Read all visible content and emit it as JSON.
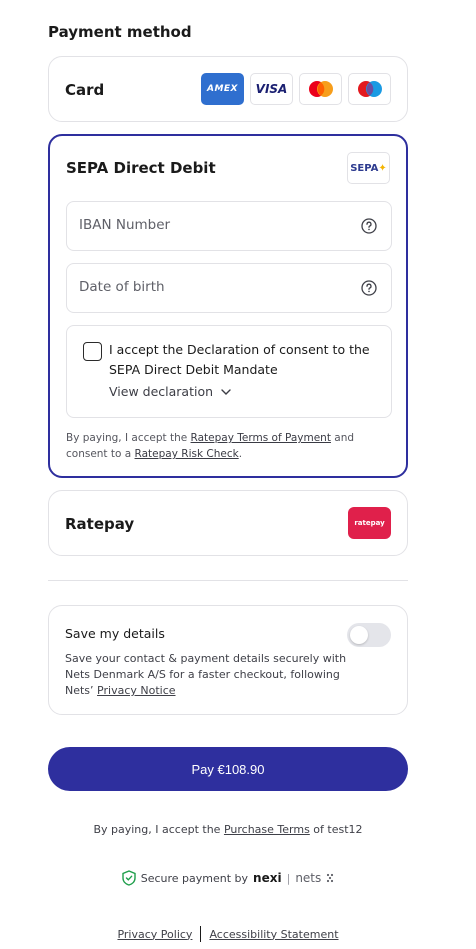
{
  "payment": {
    "title": "Payment method"
  },
  "card": {
    "label": "Card",
    "brands": [
      "AMEX",
      "VISA",
      "mastercard",
      "maestro"
    ]
  },
  "sepa": {
    "label": "SEPA Direct Debit",
    "logo_text": "SEPA",
    "iban_placeholder": "IBAN Number",
    "dob_placeholder": "Date of birth",
    "consent_text": "I accept the Declaration of consent to the SEPA Direct Debit Mandate",
    "view_declaration": "View declaration",
    "legal_prefix": "By paying, I accept the ",
    "legal_link1": "Ratepay Terms of Payment",
    "legal_mid": " and consent to a ",
    "legal_link2": "Ratepay Risk Check",
    "legal_suffix": "."
  },
  "ratepay": {
    "label": "Ratepay",
    "logo_text": "ratepay"
  },
  "save": {
    "title": "Save my details",
    "desc": "Save your contact & payment details securely with Nets Denmark A/S for a faster checkout, following Nets’ ",
    "link": "Privacy Notice",
    "enabled": false
  },
  "pay_button": {
    "label": "Pay €108.90"
  },
  "purchase_legal": {
    "prefix": "By paying, I accept the ",
    "link": "Purchase Terms",
    "suffix": " of test12"
  },
  "secure": {
    "text": "Secure payment by",
    "brand1": "nexi",
    "brand2": "nets"
  },
  "footer": {
    "privacy": "Privacy Policy",
    "accessibility": "Accessibility Statement"
  },
  "colors": {
    "accent": "#2e2f9e",
    "border": "#e2e2e6",
    "ratepay": "#e0204b",
    "amex": "#2f6fcf"
  }
}
